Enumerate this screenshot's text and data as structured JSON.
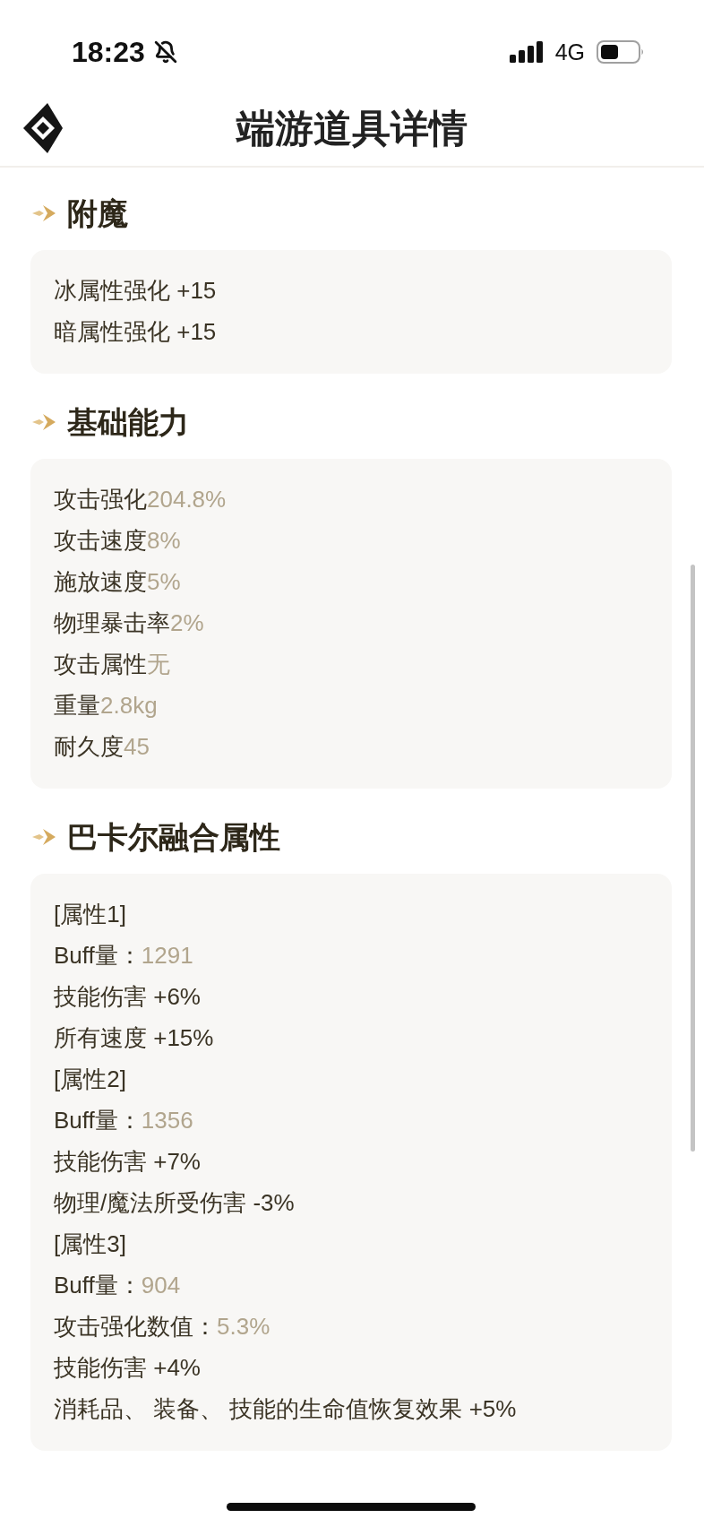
{
  "status_bar": {
    "time": "18:23",
    "network": "4G"
  },
  "header": {
    "title": "端游道具详情"
  },
  "sections": [
    {
      "title": "附魔",
      "rows": [
        {
          "kind": "plain",
          "text": "冰属性强化 +15"
        },
        {
          "kind": "plain",
          "text": "暗属性强化 +15"
        }
      ]
    },
    {
      "title": "基础能力",
      "rows": [
        {
          "kind": "pair",
          "label": "攻击强化",
          "value": "204.8%"
        },
        {
          "kind": "pair",
          "label": "攻击速度",
          "value": "8%"
        },
        {
          "kind": "pair",
          "label": "施放速度",
          "value": "5%"
        },
        {
          "kind": "pair",
          "label": "物理暴击率",
          "value": "2%"
        },
        {
          "kind": "pair",
          "label": "攻击属性",
          "value": "无"
        },
        {
          "kind": "pair",
          "label": "重量",
          "value": "2.8kg"
        },
        {
          "kind": "pair",
          "label": "耐久度",
          "value": "45"
        }
      ]
    },
    {
      "title": "巴卡尔融合属性",
      "rows": [
        {
          "kind": "plain",
          "text": "[属性1]"
        },
        {
          "kind": "pair",
          "label": "Buff量：",
          "value": "1291"
        },
        {
          "kind": "plain",
          "text": "技能伤害 +6%"
        },
        {
          "kind": "plain",
          "text": "所有速度 +15%"
        },
        {
          "kind": "plain",
          "text": "[属性2]"
        },
        {
          "kind": "pair",
          "label": "Buff量：",
          "value": "1356"
        },
        {
          "kind": "plain",
          "text": "技能伤害 +7%"
        },
        {
          "kind": "plain",
          "text": "物理/魔法所受伤害 -3%"
        },
        {
          "kind": "plain",
          "text": "[属性3]"
        },
        {
          "kind": "pair",
          "label": "Buff量：",
          "value": "904"
        },
        {
          "kind": "pair",
          "label": "攻击强化数值：",
          "value": "5.3%"
        },
        {
          "kind": "plain",
          "text": "技能伤害 +4%"
        },
        {
          "kind": "plain",
          "text": "消耗品、 装备、 技能的生命值恢复效果 +5%"
        }
      ]
    }
  ]
}
